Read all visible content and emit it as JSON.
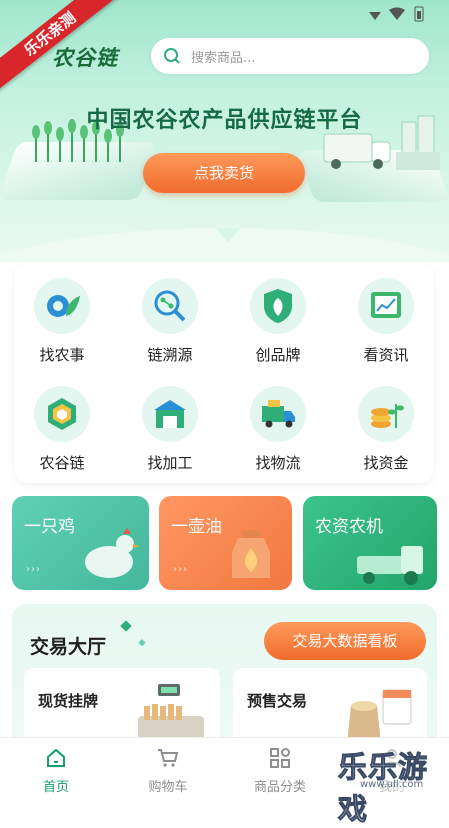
{
  "watermark_ribbon": "乐乐亲测",
  "app": {
    "logo_text": "农谷链"
  },
  "search": {
    "placeholder": "搜索商品..."
  },
  "hero": {
    "title": "中国农谷农产品供应链平台",
    "cta_label": "点我卖货"
  },
  "services": [
    {
      "label": "找农事",
      "icon": "gear-leaf-icon"
    },
    {
      "label": "链溯源",
      "icon": "magnifier-network-icon"
    },
    {
      "label": "创品牌",
      "icon": "shield-leaf-icon"
    },
    {
      "label": "看资讯",
      "icon": "chart-board-icon"
    },
    {
      "label": "农谷链",
      "icon": "layered-hexagon-icon"
    },
    {
      "label": "找加工",
      "icon": "factory-icon"
    },
    {
      "label": "找物流",
      "icon": "truck-icon"
    },
    {
      "label": "找资金",
      "icon": "coins-plant-icon"
    }
  ],
  "categories": [
    {
      "title": "一只鸡",
      "color": "#52c6a9"
    },
    {
      "title": "一壶油",
      "color": "#f7874e"
    },
    {
      "title": "农资农机",
      "color": "#35b97a"
    }
  ],
  "trading_hall": {
    "title": "交易大厅",
    "dashboard_button": "交易大数据看板",
    "cards": [
      {
        "title": "现货挂牌"
      },
      {
        "title": "预售交易"
      }
    ]
  },
  "tabbar": [
    {
      "label": "首页",
      "icon": "home-icon",
      "active": true
    },
    {
      "label": "购物车",
      "icon": "cart-icon",
      "active": false
    },
    {
      "label": "商品分类",
      "icon": "grid-icon",
      "active": false
    },
    {
      "label": "我的",
      "icon": "user-icon",
      "active": false
    }
  ],
  "watermark": {
    "text": "乐乐游戏",
    "sub": "www.ull.com"
  },
  "colors": {
    "accent": "#17a06a",
    "orange": "#f06b2c",
    "title_green": "#166b46"
  }
}
